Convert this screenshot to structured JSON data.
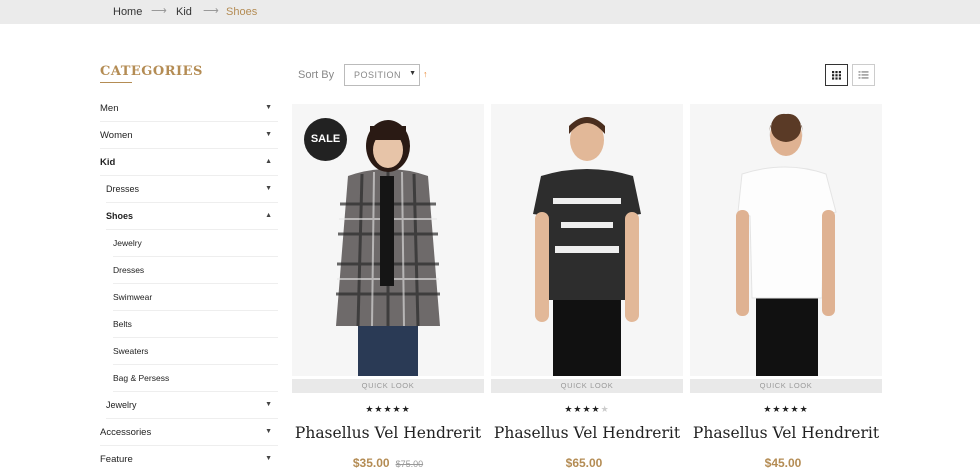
{
  "breadcrumb": {
    "home": "Home",
    "kid": "Kid",
    "current": "Shoes",
    "separator": "⟶"
  },
  "sidebar": {
    "title": "CATEGORIES",
    "items": [
      {
        "label": "Men",
        "arrow": "▼"
      },
      {
        "label": "Women",
        "arrow": "▼"
      },
      {
        "label": "Kid",
        "arrow": "▲"
      },
      {
        "label": "Dresses",
        "arrow": "▼"
      },
      {
        "label": "Shoes",
        "arrow": "▲"
      },
      {
        "label": "Jewelry",
        "arrow": ""
      },
      {
        "label": "Dresses",
        "arrow": ""
      },
      {
        "label": "Swimwear",
        "arrow": ""
      },
      {
        "label": "Belts",
        "arrow": ""
      },
      {
        "label": "Sweaters",
        "arrow": ""
      },
      {
        "label": "Bag & Persess",
        "arrow": ""
      },
      {
        "label": "Jewelry",
        "arrow": "▼"
      },
      {
        "label": "Accessories",
        "arrow": "▼"
      },
      {
        "label": "Feature",
        "arrow": "▼"
      }
    ]
  },
  "toolbar": {
    "sort_label": "Sort By",
    "sort_value": "POSITION",
    "sort_caret": "▼",
    "sort_direction": "↑",
    "active_view": "grid"
  },
  "products": [
    {
      "sale": "SALE",
      "quick_look": "QUICK LOOK",
      "stars_on": "★★★★★",
      "stars_off": "",
      "name": "Phasellus Vel Hendrerit",
      "price": "$35.00",
      "old_price": "$75.00",
      "rating": 5
    },
    {
      "sale": "",
      "quick_look": "QUICK LOOK",
      "stars_on": "★★★★",
      "stars_off": "★",
      "name": "Phasellus Vel Hendrerit",
      "price": "$65.00",
      "old_price": "",
      "rating": 4
    },
    {
      "sale": "",
      "quick_look": "QUICK LOOK",
      "stars_on": "★★★★★",
      "stars_off": "",
      "name": "Phasellus Vel Hendrerit",
      "price": "$45.00",
      "old_price": "",
      "rating": 4.5
    }
  ],
  "colors": {
    "accent": "#b48c54",
    "sort_arrow": "#e8842c",
    "sale_badge": "#222222"
  },
  "icons": {
    "grid_view": "grid-icon",
    "list_view": "list-icon"
  }
}
